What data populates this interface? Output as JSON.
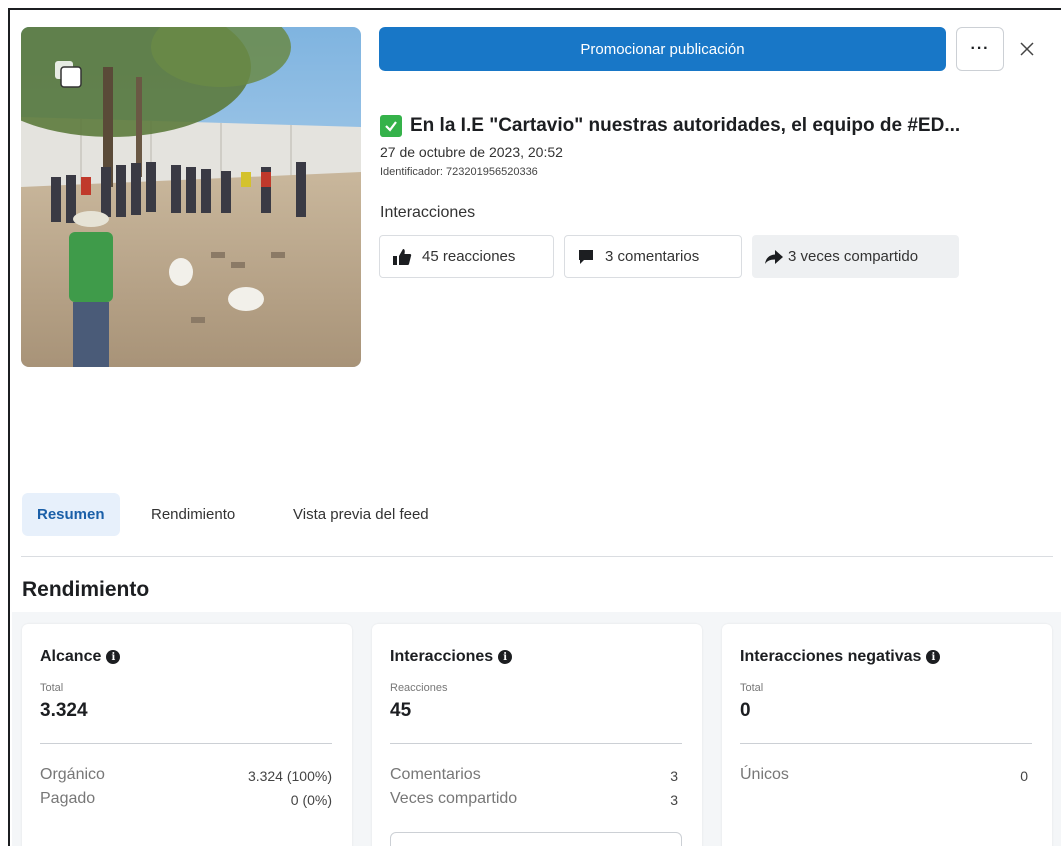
{
  "header": {
    "promote_label": "Promocionar publicación",
    "more_label": "···",
    "close_icon": "close-icon"
  },
  "post": {
    "title": "En la I.E \"Cartavio\" nuestras autoridades, el equipo de #ED...",
    "date": "27 de octubre de 2023, 20:52",
    "identifier": "Identificador: 723201956520336",
    "interactions_label": "Interacciones",
    "pills": [
      {
        "icon": "thumbs-up-icon",
        "label": "45 reacciones"
      },
      {
        "icon": "comment-icon",
        "label": "3 comentarios"
      },
      {
        "icon": "share-icon",
        "label": "3 veces compartido"
      }
    ]
  },
  "tabs": [
    {
      "label": "Resumen",
      "active": true
    },
    {
      "label": "Rendimiento",
      "active": false
    },
    {
      "label": "Vista previa del feed",
      "active": false
    }
  ],
  "section_title": "Rendimiento",
  "cards": {
    "alcance": {
      "title": "Alcance",
      "sub": "Total",
      "value": "3.324",
      "rows": [
        {
          "label": "Orgánico",
          "value": "3.324 (100%)"
        },
        {
          "label": "Pagado",
          "value": "0 (0%)"
        }
      ]
    },
    "interacciones": {
      "title": "Interacciones",
      "sub": "Reacciones",
      "value": "45",
      "rows": [
        {
          "label": "Comentarios",
          "value": "3"
        },
        {
          "label": "Veces compartido",
          "value": "3"
        }
      ]
    },
    "negativas": {
      "title": "Interacciones negativas",
      "sub": "Total",
      "value": "0",
      "rows": [
        {
          "label": "Únicos",
          "value": "0"
        }
      ]
    }
  },
  "colors": {
    "primary": "#1877c7",
    "check": "#35b24a",
    "tab_active_bg": "#e7f0fb",
    "tab_active_text": "#1a5fa8"
  }
}
